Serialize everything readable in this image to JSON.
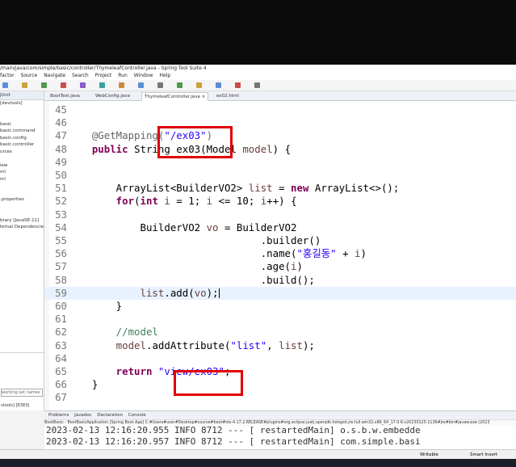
{
  "window": {
    "title": "/main/java/com/simple/basic/controller/ThymeleafController.java - Spring Tool Suite 4"
  },
  "menu": [
    "factor",
    "Source",
    "Navigate",
    "Search",
    "Project",
    "Run",
    "Window",
    "Help"
  ],
  "left_panel": {
    "tab": "JUnit",
    "items": [
      "[devtools]",
      "",
      "",
      "basic",
      "basic.command",
      "basic.config",
      "basic.controller",
      "urces",
      "",
      "iew",
      "ml",
      "ml",
      "",
      "",
      ".properties",
      "",
      "",
      "brary [JavaSE-11]",
      "ternal Dependencies"
    ],
    "filter_placeholder": "working set names",
    "bottom_item": "vtools] [6383]"
  },
  "editor_tabs": [
    "BootTest.java",
    "WebConfig.java",
    "ThymeleafController.java",
    "ex02.html"
  ],
  "code": {
    "lines": [
      {
        "n": "45",
        "t": []
      },
      {
        "n": "46",
        "t": []
      },
      {
        "n": "47",
        "t": [
          [
            "ann",
            "    @GetMapping("
          ],
          [
            "str",
            "\"/ex03\""
          ],
          [
            "ann",
            ")"
          ]
        ]
      },
      {
        "n": "48",
        "t": [
          [
            "kw",
            "    public "
          ],
          [
            "plain",
            "String ex03(Model "
          ],
          [
            "var",
            "model"
          ],
          [
            "plain",
            ") {"
          ]
        ]
      },
      {
        "n": "49",
        "t": []
      },
      {
        "n": "50",
        "t": []
      },
      {
        "n": "51",
        "t": [
          [
            "plain",
            "        ArrayList<BuilderVO2> "
          ],
          [
            "var",
            "list"
          ],
          [
            "plain",
            " = "
          ],
          [
            "kw",
            "new"
          ],
          [
            "plain",
            " ArrayList<>();"
          ]
        ]
      },
      {
        "n": "52",
        "t": [
          [
            "kw",
            "        for"
          ],
          [
            "plain",
            "("
          ],
          [
            "kw",
            "int"
          ],
          [
            "plain",
            " "
          ],
          [
            "var",
            "i"
          ],
          [
            "plain",
            " = 1; "
          ],
          [
            "var",
            "i"
          ],
          [
            "plain",
            " <= 10; "
          ],
          [
            "var",
            "i"
          ],
          [
            "plain",
            "++) {"
          ]
        ]
      },
      {
        "n": "53",
        "t": []
      },
      {
        "n": "54",
        "t": [
          [
            "plain",
            "            BuilderVO2 "
          ],
          [
            "var",
            "vo"
          ],
          [
            "plain",
            " = BuilderVO2"
          ]
        ]
      },
      {
        "n": "55",
        "t": [
          [
            "plain",
            "                                .builder()"
          ]
        ]
      },
      {
        "n": "56",
        "t": [
          [
            "plain",
            "                                .name("
          ],
          [
            "str",
            "\"홍길동\""
          ],
          [
            "plain",
            " + "
          ],
          [
            "var",
            "i"
          ],
          [
            "plain",
            ")"
          ]
        ]
      },
      {
        "n": "57",
        "t": [
          [
            "plain",
            "                                .age("
          ],
          [
            "var",
            "i"
          ],
          [
            "plain",
            ")"
          ]
        ]
      },
      {
        "n": "58",
        "t": [
          [
            "plain",
            "                                .build();"
          ]
        ]
      },
      {
        "n": "59",
        "t": [
          [
            "var",
            "            list"
          ],
          [
            "plain",
            ".add("
          ],
          [
            "var",
            "vo"
          ],
          [
            "plain",
            ");"
          ]
        ]
      },
      {
        "n": "60",
        "t": [
          [
            "plain",
            "        }"
          ]
        ]
      },
      {
        "n": "61",
        "t": []
      },
      {
        "n": "62",
        "t": [
          [
            "cm",
            "        //model"
          ]
        ]
      },
      {
        "n": "63",
        "t": [
          [
            "var",
            "        model"
          ],
          [
            "plain",
            ".addAttribute("
          ],
          [
            "str",
            "\"list\""
          ],
          [
            "plain",
            ", "
          ],
          [
            "var",
            "list"
          ],
          [
            "plain",
            ");"
          ]
        ]
      },
      {
        "n": "64",
        "t": []
      },
      {
        "n": "65",
        "t": [
          [
            "kw",
            "        return "
          ],
          [
            "str",
            "\"view/ex03\""
          ],
          [
            "plain",
            ";"
          ]
        ]
      },
      {
        "n": "66",
        "t": [
          [
            "plain",
            "    }"
          ]
        ]
      },
      {
        "n": "67",
        "t": []
      }
    ]
  },
  "console": {
    "tabs": [
      "Problems",
      "Javadoc",
      "Declaration",
      "Console"
    ],
    "path": "BootBasic - BootBasicApplication [Spring Boot App] C:#Users#user#Desktop#course#boot#sts-4.17.2.RELEASE#plugins#org.eclipse.justj.openjdk.hotspot.jre.full.win32.x86_64_17.0.6.v20230125-1136#jre#bin#javaw.exe (2023",
    "line1": "2023-02-13 12:16:20.955  INFO 8712 --- [  restartedMain] o.s.b.w.embedde",
    "line2": "2023-02-13 12:16:20.957  INFO 8712 --- [  restartedMain] com.simple.basi"
  },
  "status": {
    "writable": "Writable",
    "insert": "Smart Insert"
  }
}
